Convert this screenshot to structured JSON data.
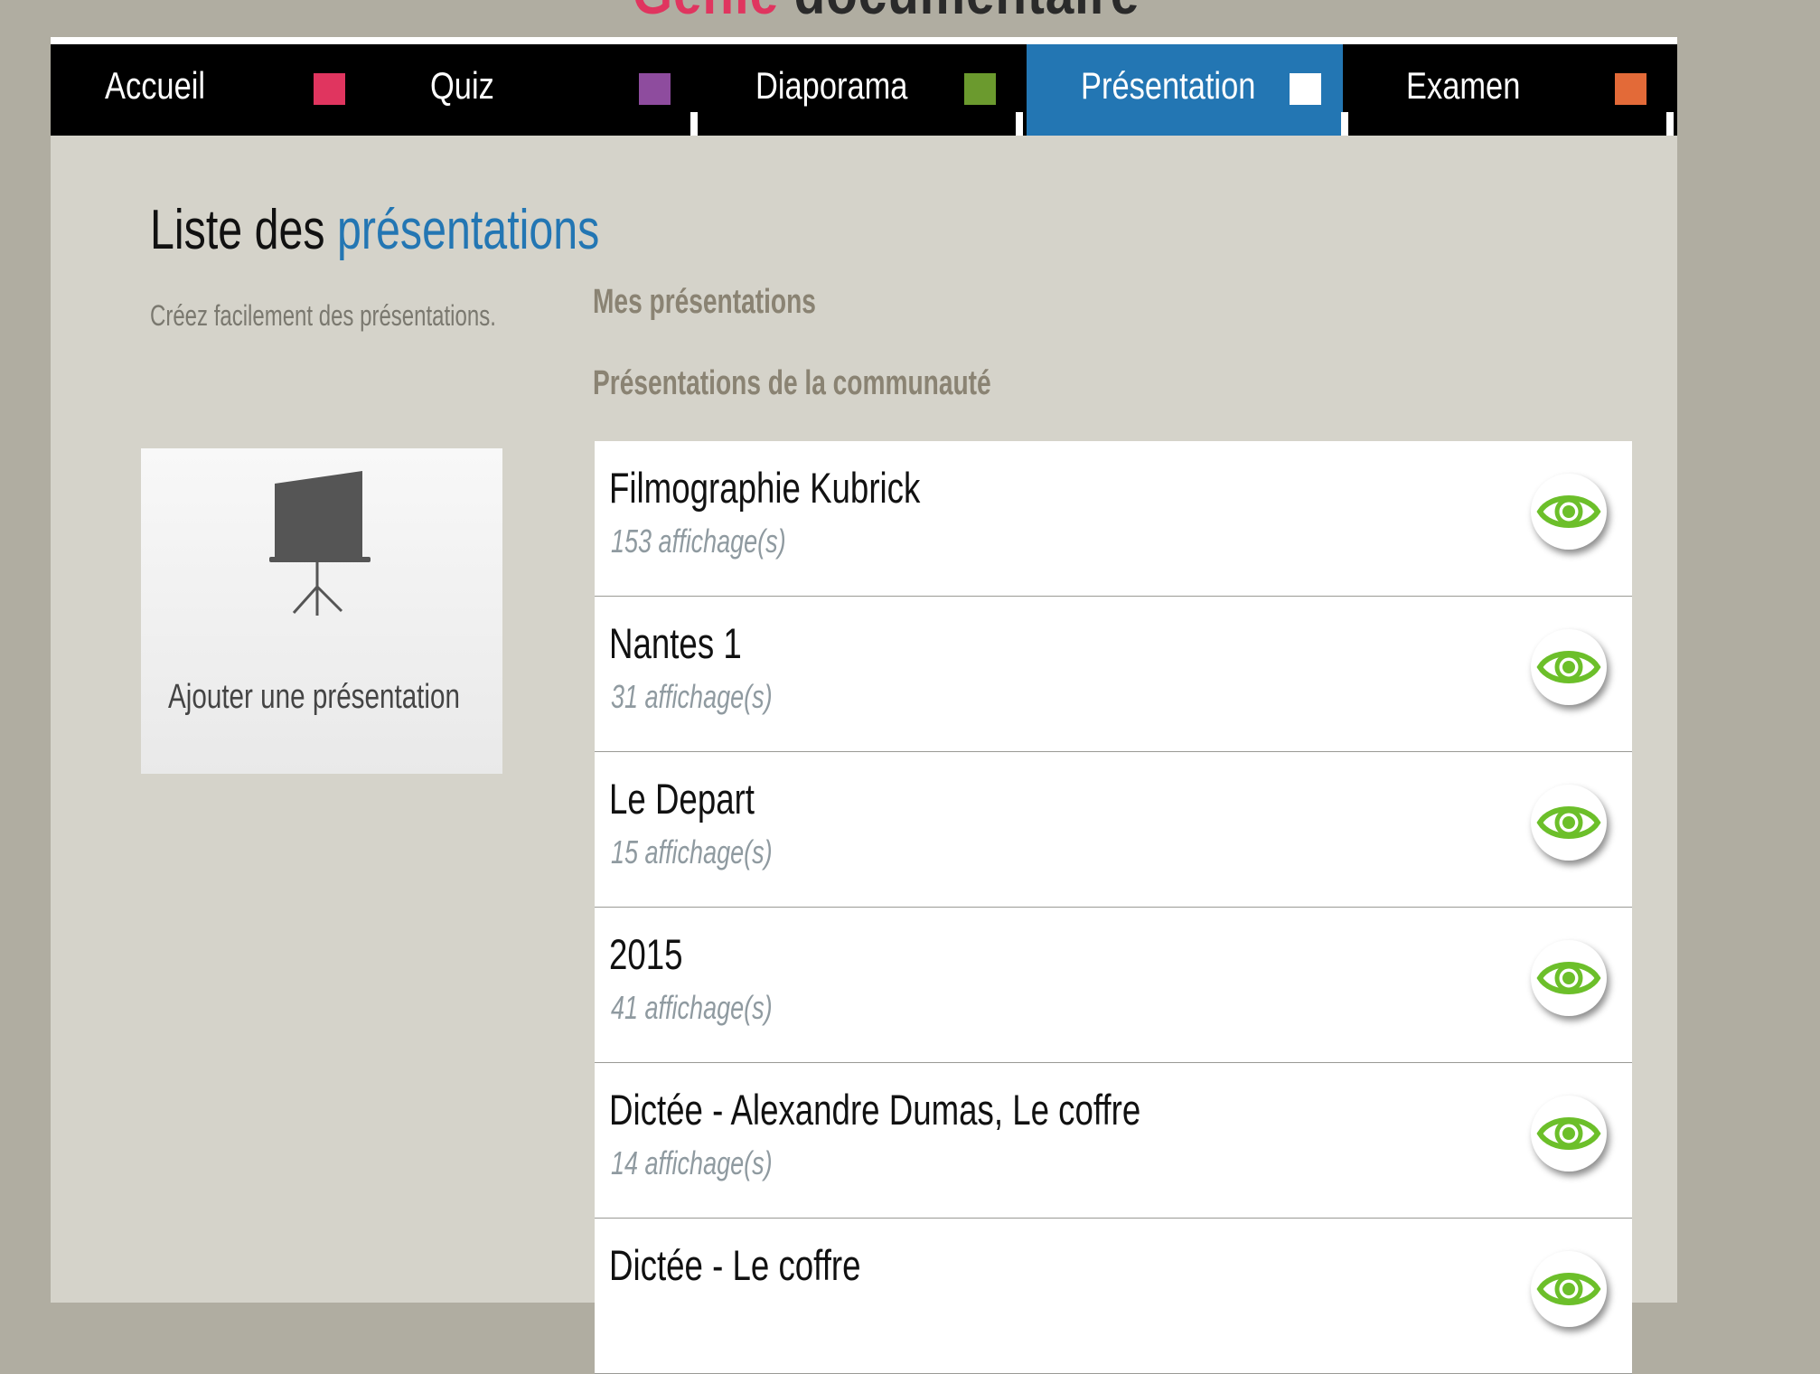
{
  "site": {
    "title_accent": "Génie",
    "title_rest": " documentaire"
  },
  "nav": {
    "items": [
      {
        "label": "Accueil",
        "color": "#e0355f"
      },
      {
        "label": "Quiz",
        "color": "#8e4c9e"
      },
      {
        "label": "Diaporama",
        "color": "#6b9a2e"
      },
      {
        "label": "Présentation",
        "color": "#ffffff",
        "active": true
      },
      {
        "label": "Examen",
        "color": "#e36a38"
      }
    ]
  },
  "page": {
    "title_prefix": "Liste des ",
    "title_accent": "présentations",
    "subtitle": "Créez facilement des présentations."
  },
  "filters": {
    "mine": "Mes présentations",
    "community": "Présentations de la communauté"
  },
  "add_card": {
    "label": "Ajouter une présentation",
    "icon": "projector-screen-icon"
  },
  "presentations": [
    {
      "title": "Filmographie Kubrick",
      "views": "153 affichage(s)"
    },
    {
      "title": "Nantes 1",
      "views": "31 affichage(s)"
    },
    {
      "title": "Le Depart",
      "views": "15 affichage(s)"
    },
    {
      "title": "2015",
      "views": "41 affichage(s)"
    },
    {
      "title": "Dictée - Alexandre Dumas, Le coffre",
      "views": "14 affichage(s)"
    },
    {
      "title": "Dictée - Le coffre",
      "views": ""
    }
  ],
  "colors": {
    "accent_blue": "#2376b3",
    "eye_green": "#6cbf2a"
  }
}
